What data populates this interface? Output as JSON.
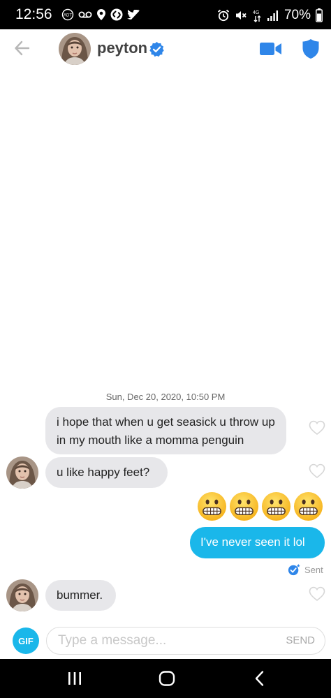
{
  "status_bar": {
    "time": "12:56",
    "left_icons": [
      "adt-icon",
      "voicemail-icon",
      "location-pin-icon",
      "shazam-icon",
      "twitter-icon"
    ],
    "right_icons": [
      "alarm-icon",
      "mute-icon",
      "wifi-calling-icon",
      "signal-icon",
      "battery-icon"
    ],
    "battery": "70%"
  },
  "header": {
    "name": "peyton",
    "verified": true,
    "accent": "#2f86e9",
    "icons": [
      "back-arrow-icon",
      "verified-badge-icon",
      "video-call-icon",
      "safety-shield-icon"
    ]
  },
  "chat": {
    "timestamp_date": "Sun, Dec 20, 2020,",
    "timestamp_time": "10:50 PM",
    "messages": [
      {
        "from": "peyton",
        "text": "i hope that when u get seasick u throw up in my mouth like a momma penguin"
      },
      {
        "from": "peyton",
        "text": "u like happy feet?"
      },
      {
        "from": "me",
        "text": "😬😬😬😬",
        "kind": "emoji"
      },
      {
        "from": "me",
        "text": "I've never seen it lol",
        "status": "Sent"
      },
      {
        "from": "peyton",
        "text": "bummer."
      }
    ],
    "incoming_bubble_color": "#e7e7ea",
    "outgoing_bubble_color": "#1ab7ea"
  },
  "composer": {
    "gif_label": "GIF",
    "placeholder": "Type a message...",
    "value": "",
    "send_label": "SEND"
  },
  "nav_bar": {
    "buttons": [
      "recent-apps-icon",
      "home-icon",
      "back-icon"
    ]
  }
}
